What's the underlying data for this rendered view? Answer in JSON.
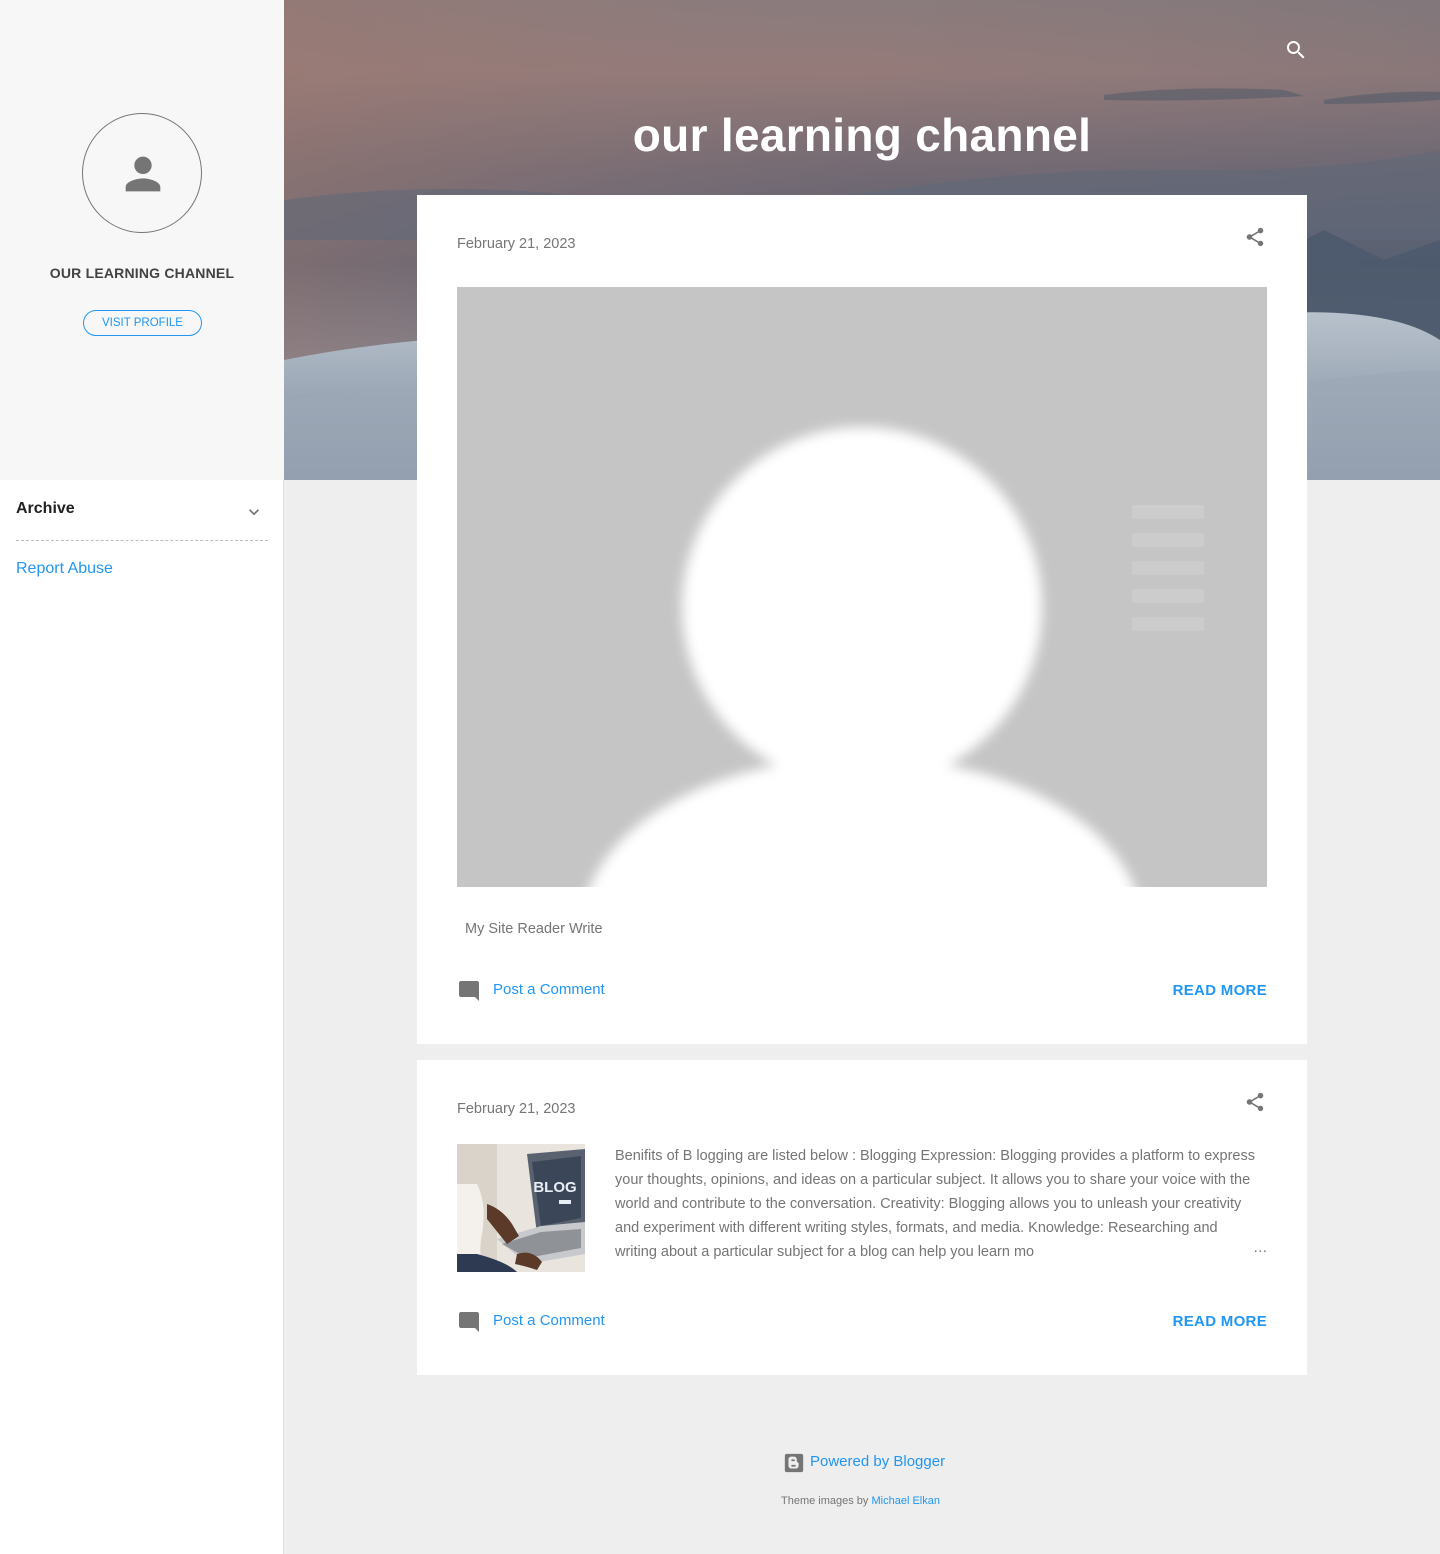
{
  "sidebar": {
    "profile_name": "OUR LEARNING CHANNEL",
    "visit_profile_label": "VISIT PROFILE",
    "archive_label": "Archive",
    "report_abuse_label": "Report Abuse"
  },
  "header": {
    "title": "our learning channel"
  },
  "posts": [
    {
      "date": "February 21, 2023",
      "snippet": "My Site Reader Write",
      "comment_label": "Post a Comment",
      "read_more_label": "READ MORE"
    },
    {
      "date": "February 21, 2023",
      "snippet": "Benifits of B logging are listed below : Blogging Expression: Blogging provides a platform to express your thoughts, opinions, and ideas on a particular subject. It allows you to share your voice with the world and contribute to the conversation. Creativity: Blogging allows you to unleash your creativity and experiment with different writing styles, formats, and media. Knowledge: Researching and writing about a particular subject for a blog can help you learn mo",
      "ellipsis": "…",
      "comment_label": "Post a Comment",
      "read_more_label": "READ MORE"
    }
  ],
  "footer": {
    "powered_label": "Powered by Blogger",
    "theme_prefix": "Theme images by ",
    "theme_author": "Michael Elkan"
  },
  "colors": {
    "accent": "#2196f3",
    "text": "#757575",
    "background": "#eeeeee"
  },
  "icons": {
    "search": "search-icon",
    "share": "share-icon",
    "comment": "comment-icon",
    "avatar": "person-icon",
    "chevron": "chevron-down-icon",
    "blogger": "blogger-logo-icon"
  }
}
